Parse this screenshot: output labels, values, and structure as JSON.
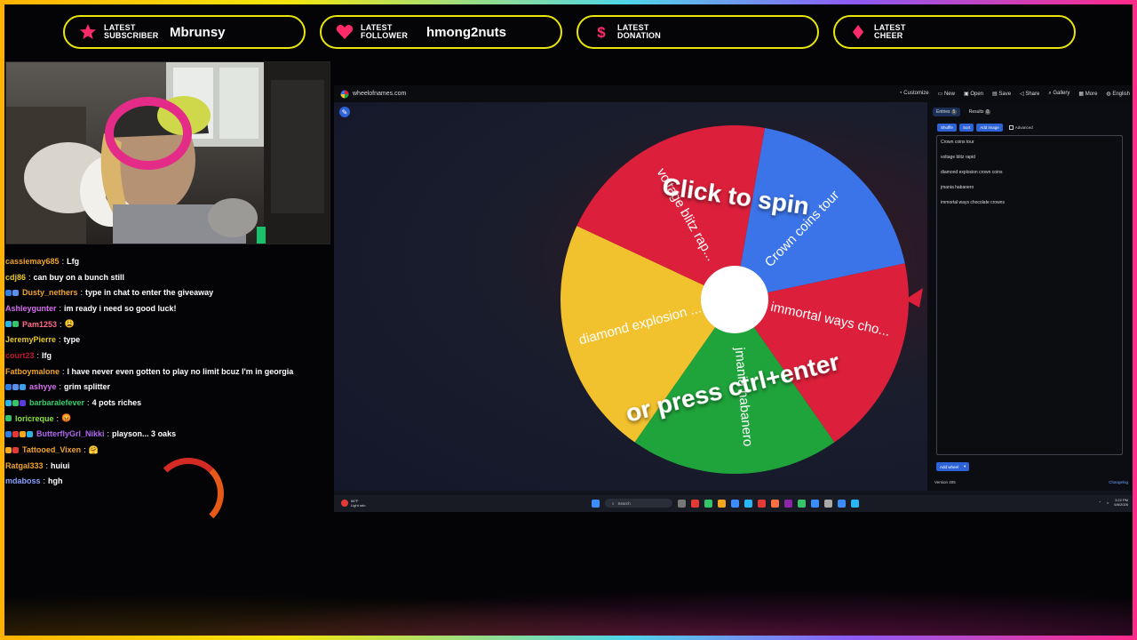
{
  "alerts": [
    {
      "line1": "LATEST",
      "line2": "SUBSCRIBER",
      "value": "Mbrunsy",
      "icon": "star-icon"
    },
    {
      "line1": "LATEST",
      "line2": "FOLLOWER",
      "value": "hmong2nuts",
      "icon": "heart-icon"
    },
    {
      "line1": "LATEST",
      "line2": "DONATION",
      "value": "",
      "icon": "dollar-icon"
    },
    {
      "line1": "LATEST",
      "line2": "CHEER",
      "value": "",
      "icon": "bits-icon"
    }
  ],
  "colors": {
    "accent_yellow": "#e8e60a",
    "wheel_red": "#dc1f3a",
    "wheel_blue": "#3b74e8",
    "wheel_yellow": "#f2c12e",
    "wheel_green": "#1fa33b",
    "link_blue": "#2d63d6"
  },
  "chat": [
    {
      "user": "cassiemay685",
      "color": "#f0a32b",
      "msg": "Lfg",
      "badges": []
    },
    {
      "user": "cdj86",
      "color": "#e6c829",
      "msg": "can buy on a bunch still",
      "badges": []
    },
    {
      "user": "Dusty_nethers",
      "color": "#f0a32b",
      "msg": "type in chat to enter the giveaway",
      "badges": [
        "#2f7de1",
        "#5a8ff0"
      ]
    },
    {
      "user": "Ashleygunter",
      "color": "#d76ef0",
      "msg": "im ready i need so good luck!",
      "badges": []
    },
    {
      "user": "Pam1253",
      "color": "#ff6a8a",
      "msg": "😩",
      "badges": [
        "#2bb3e6",
        "#35c46a"
      ]
    },
    {
      "user": "JeremyPierre",
      "color": "#e6c829",
      "msg": "type",
      "badges": []
    },
    {
      "user": "court23",
      "color": "#c0142f",
      "msg": "lfg",
      "badges": []
    },
    {
      "user": "Fatboymalone",
      "color": "#f0a32b",
      "msg": "I have never even gotten to play no limit bcuz I'm in georgia",
      "badges": []
    },
    {
      "user": "ashyye",
      "color": "#d76ef0",
      "msg": "grim splitter",
      "badges": [
        "#2f7de1",
        "#5a8ff0",
        "#3aa0e8"
      ]
    },
    {
      "user": "barbaralefever",
      "color": "#35d06d",
      "msg": "4 pots riches",
      "badges": [
        "#2bb3e6",
        "#35c46a",
        "#5b3be0"
      ]
    },
    {
      "user": "loricreque",
      "color": "#8ae23c",
      "msg": "😡",
      "badges": [
        "#35c46a"
      ]
    },
    {
      "user": "ButterflyGrl_Nikki",
      "color": "#b065f0",
      "msg": "playson... 3 oaks",
      "badges": [
        "#2f7de1",
        "#e53935",
        "#f2a71e",
        "#2bb3e6"
      ]
    },
    {
      "user": "Tattooed_Vixen",
      "color": "#f0a32b",
      "msg": "🤗",
      "badges": [
        "#f2a71e",
        "#e53935"
      ]
    },
    {
      "user": "Ratgal333",
      "color": "#f0a32b",
      "msg": "huiui",
      "badges": []
    },
    {
      "user": "mdaboss",
      "color": "#8aa0ff",
      "msg": "hgh",
      "badges": []
    }
  ],
  "browser": {
    "url": "wheelofnames.com",
    "nav": [
      "Customize",
      "New",
      "Open",
      "Save",
      "Share",
      "Gallery",
      "More",
      "English"
    ]
  },
  "wheel": {
    "prompt_top": "Click to spin",
    "prompt_bottom": "or press ctrl+enter",
    "slices": [
      {
        "label": "Crown coins tour",
        "color": "#3b74e8"
      },
      {
        "label": "immortal ways cho...",
        "color": "#dc1f3a"
      },
      {
        "label": "jmania habanero",
        "color": "#1fa33b"
      },
      {
        "label": "diamond explosion ...",
        "color": "#f2c12e"
      },
      {
        "label": "voltage blitz rap...",
        "color": "#dc1f3a"
      }
    ]
  },
  "panel": {
    "tabs": [
      "Entries",
      "Results"
    ],
    "entries_count": "5",
    "results_count": "0",
    "buttons": [
      "Shuffle",
      "Sort",
      "Add image"
    ],
    "advanced": "Advanced",
    "entries": [
      "Crown coins tour",
      "voltage blitz rapid",
      "diamond explosion crown coins",
      "jmania habanero",
      "immortal ways chocolate crowns"
    ],
    "add_wheel": "Add wheel",
    "version": "Version 405",
    "changelog": "Changelog"
  },
  "taskbar": {
    "weather_temp": "66°F",
    "weather_desc": "Light rain",
    "search": "Search",
    "time": "3:22 PM",
    "date": "6/6/2026"
  }
}
